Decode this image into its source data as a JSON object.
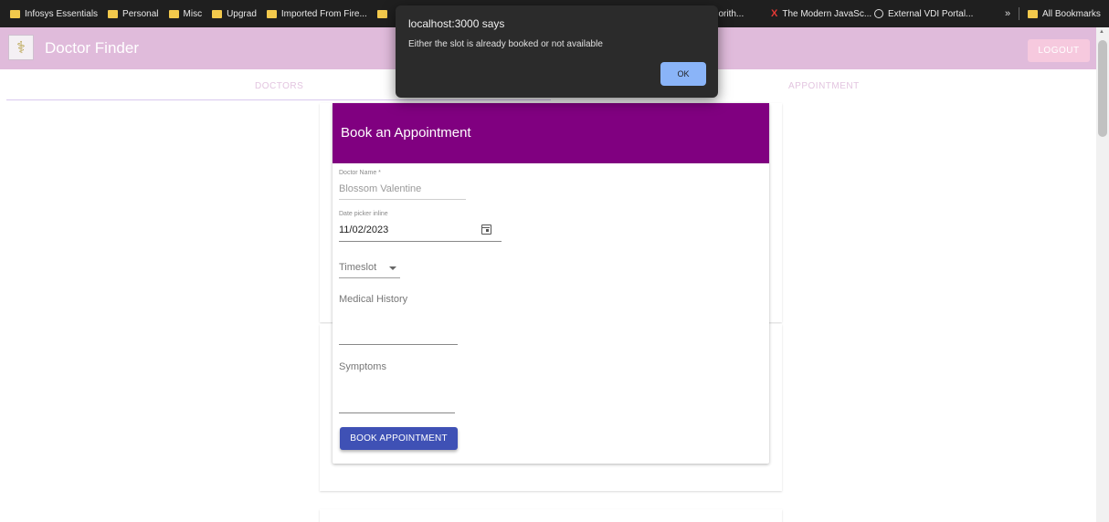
{
  "bookmarks": {
    "items": [
      {
        "label": "Infosys Essentials"
      },
      {
        "label": "Personal"
      },
      {
        "label": "Misc"
      },
      {
        "label": "Upgrad"
      },
      {
        "label": "Imported From Fire..."
      }
    ],
    "right_items": [
      {
        "label": "Algorith..."
      },
      {
        "label": "The Modern JavaSc..."
      },
      {
        "label": "External VDI Portal..."
      }
    ],
    "overflow_label": "»",
    "all_bookmarks_label": "All Bookmarks"
  },
  "appbar": {
    "title": "Doctor Finder",
    "logout_label": "LOGOUT",
    "logo_glyph": "⚕",
    "color": "#e0bbdb"
  },
  "tabs": {
    "doctors": "DOCTORS",
    "appointment": "APPOINTMENT"
  },
  "modal": {
    "title": "Book an Appointment",
    "header_color": "#800080",
    "doctor_name_label": "Doctor Name *",
    "doctor_name_value": "Blossom Valentine",
    "date_label": "Date picker inline",
    "date_value": "11/02/2023",
    "timeslot_label": "Timeslot",
    "medical_history_label": "Medical History",
    "symptoms_label": "Symptoms",
    "book_button_label": "BOOK APPOINTMENT",
    "button_color": "#3f51b5"
  },
  "alert": {
    "title": "localhost:3000 says",
    "message": "Either the slot is already booked or not available",
    "ok_label": "OK"
  }
}
